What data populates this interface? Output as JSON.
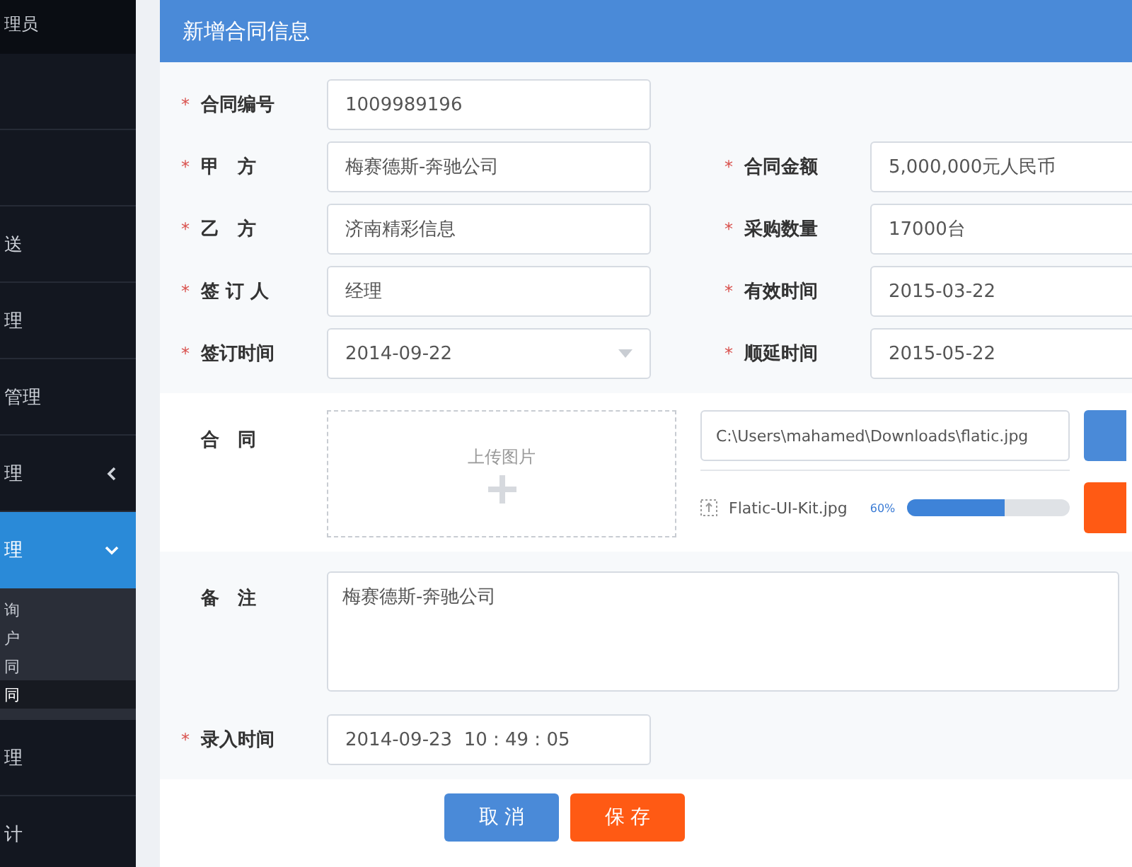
{
  "sidebar": {
    "user_role": "理员",
    "items": [
      {
        "selected": false
      },
      {
        "selected": false
      },
      {
        "label": "送",
        "selected": false
      },
      {
        "label": "理",
        "selected": false
      },
      {
        "label": "管理",
        "selected": false
      },
      {
        "label": "理",
        "expanded": false,
        "selected": false
      },
      {
        "label": "理",
        "expanded": true,
        "selected": true,
        "children": [
          {
            "label": "询",
            "selected": false
          },
          {
            "label": "户",
            "selected": false
          },
          {
            "label": "同",
            "selected": false
          },
          {
            "label": "同",
            "selected": true
          }
        ]
      },
      {
        "label": "理",
        "selected": false
      },
      {
        "label": "计",
        "selected": false
      }
    ]
  },
  "form": {
    "title": "新增合同信息",
    "rows": [
      [
        {
          "mark": "*",
          "label": "合同编号",
          "value": "1009989196",
          "dropdown": false
        }
      ],
      [
        {
          "mark": "*",
          "label": "甲　方",
          "value": "梅赛德斯-奔驰公司",
          "dropdown": false
        },
        {
          "mark": "*",
          "label": "合同金额",
          "value": "5,000,000元人民币",
          "dropdown": false
        }
      ],
      [
        {
          "mark": "*",
          "label": "乙　方",
          "value": "济南精彩信息",
          "dropdown": false
        },
        {
          "mark": "*",
          "label": "采购数量",
          "value": "17000台",
          "dropdown": false
        }
      ],
      [
        {
          "mark": "*",
          "label": "签 订 人",
          "value": "经理",
          "dropdown": false
        },
        {
          "mark": "*",
          "label": "有效时间",
          "value": "2015-03-22",
          "dropdown": false
        }
      ],
      [
        {
          "mark": "*",
          "label": "签订时间",
          "value": "2014-09-22",
          "dropdown": true
        },
        {
          "mark": "*",
          "label": "顺延时间",
          "value": "2015-05-22",
          "dropdown": false
        }
      ]
    ],
    "upload": {
      "label": "合　同",
      "drop_text": "上传图片",
      "path": "C:\\Users\\mahamed\\Downloads\\flatic.jpg",
      "file_name": "Flatic-UI-Kit.jpg",
      "percent": "60%",
      "level": 0.6
    },
    "remark": {
      "label": "备　注",
      "value": "梅赛德斯-奔驰公司"
    },
    "entry_time": {
      "mark": "*",
      "label": "录入时间",
      "value": "2014-09-23  10 : 49 : 05"
    },
    "buttons": [
      {
        "label": "取 消",
        "kind": "primary"
      },
      {
        "label": "保 存",
        "kind": "danger"
      }
    ]
  }
}
